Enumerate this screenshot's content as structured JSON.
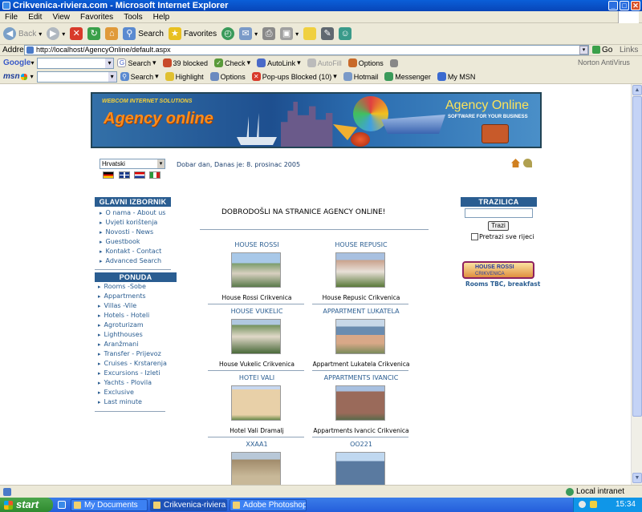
{
  "window": {
    "title": "Crikvenica-riviera.com - Microsoft Internet Explorer"
  },
  "menu": [
    "File",
    "Edit",
    "View",
    "Favorites",
    "Tools",
    "Help"
  ],
  "toolbar": {
    "back": "Back",
    "search": "Search",
    "favorites": "Favorites"
  },
  "address": {
    "label": "Address",
    "url": "http://localhost/AgencyOnline/default.aspx",
    "go": "Go",
    "links": "Links"
  },
  "google_bar": {
    "logo": "Google",
    "search": "Search",
    "blocked": "39 blocked",
    "check": "Check",
    "autolink": "AutoLink",
    "autofill": "AutoFill",
    "options": "Options",
    "antivirus": "Norton AntiVirus"
  },
  "msn_bar": {
    "logo": "msn",
    "search": "Search",
    "highlight": "Highlight",
    "options": "Options",
    "popups": "Pop-ups Blocked (10)",
    "hotmail": "Hotmail",
    "messenger": "Messenger",
    "mymsn": "My MSN"
  },
  "banner": {
    "tag": "WEBCOM INTERNET SOLUTIONS",
    "logo": "Agency online",
    "title": "Agency Online",
    "subtitle": "SOFTWARE FOR YOUR BUSINESS"
  },
  "language": {
    "selected": "Hrvatski"
  },
  "greeting": "Dobar dan, Danas je: 8. prosinac 2005",
  "main_menu": {
    "title": "GLAVNI IZBORNIK",
    "items": [
      "O nama - About us",
      "Uvjeti korištenja",
      "Novosti - News",
      "Guestbook",
      "Kontakt - Contact",
      "Advanced Search"
    ]
  },
  "offer_menu": {
    "title": "PONUDA",
    "items": [
      "Rooms -Sobe",
      "Appartments",
      "Villas -Vile",
      "Hotels - Hoteli",
      "Agroturizam",
      "Lighthouses",
      "Aranžmani",
      "Transfer - Prijevoz",
      "Cruises - Krstarenja",
      "Excursions - Izleti",
      "Yachts - Plovila",
      "Exclusive",
      "Last minute"
    ]
  },
  "welcome": "DOBRODOŠLI NA STRANICE AGENCY ONLINE!",
  "properties": [
    {
      "title": "HOUSE ROSSI",
      "caption": "House Rossi Crikvenica",
      "color": "#7a9c6a"
    },
    {
      "title": "HOUSE REPUSIC",
      "caption": "House Repusic Crikvenica",
      "color": "#8a6a5a"
    },
    {
      "title": "HOUSE VUKELIC",
      "caption": "House Vukelic Crikvenica",
      "color": "#6f8f5a"
    },
    {
      "title": "APPARTMENT LUKATELA",
      "caption": "Appartment Lukatela Crikvenica",
      "color": "#6a8cb0"
    },
    {
      "title": "HOTEl VALI",
      "caption": "Hotel Vali Dramalj",
      "color": "#c9a87a"
    },
    {
      "title": "APPARTMENTS IVANCIC",
      "caption": "Appartments Ivancic Crikvenica",
      "color": "#9a6a5a"
    },
    {
      "title": "XXAA1",
      "caption": "",
      "color": "#a08a6a"
    },
    {
      "title": "OO221",
      "caption": "",
      "color": "#5a7aa0"
    }
  ],
  "search_panel": {
    "title": "TRAZILICA",
    "button": "Trazi",
    "checkbox_label": "Pretrazi sve rijeci"
  },
  "promo": {
    "banner": "HOUSE ROSSI",
    "banner_sub": "CRIKVENICA",
    "caption": "Rooms TBC, breakfast"
  },
  "status": {
    "zone": "Local intranet"
  },
  "taskbar": {
    "start": "start",
    "tasks": [
      "My Documents",
      "Crikvenica-riviera.co...",
      "Adobe Photoshop"
    ],
    "time": "15:34"
  }
}
